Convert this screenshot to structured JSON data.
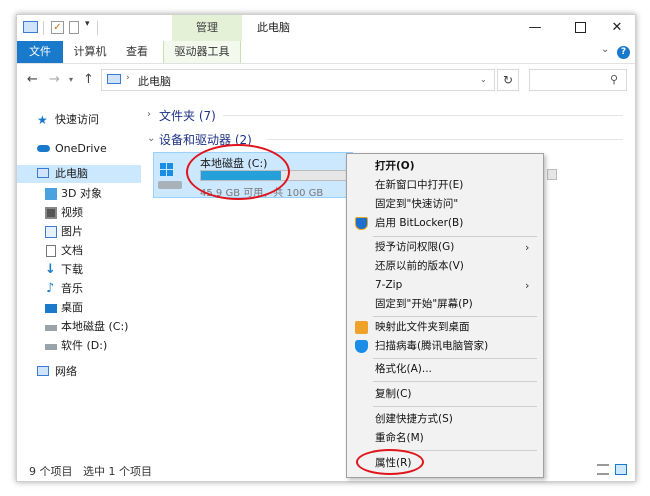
{
  "titlebar": {
    "window_title": "此电脑",
    "manage_tab": "管理",
    "minimize": "—",
    "close": "✕"
  },
  "ribbon": {
    "tabs": [
      "文件",
      "计算机",
      "查看",
      "驱动器工具"
    ],
    "help": "?"
  },
  "address": {
    "path": "此电脑"
  },
  "sidebar": {
    "items": [
      {
        "label": "快速访问",
        "icon": "star-icon"
      },
      {
        "label": "OneDrive",
        "icon": "cloud-icon"
      },
      {
        "label": "此电脑",
        "icon": "computer-icon",
        "selected": true
      },
      {
        "label": "3D 对象",
        "icon": "cube-icon"
      },
      {
        "label": "视频",
        "icon": "video-icon"
      },
      {
        "label": "图片",
        "icon": "image-icon"
      },
      {
        "label": "文档",
        "icon": "document-icon"
      },
      {
        "label": "下载",
        "icon": "download-icon"
      },
      {
        "label": "音乐",
        "icon": "music-icon"
      },
      {
        "label": "桌面",
        "icon": "desktop-icon"
      },
      {
        "label": "本地磁盘 (C:)",
        "icon": "drive-icon"
      },
      {
        "label": "软件 (D:)",
        "icon": "drive-icon"
      },
      {
        "label": "网络",
        "icon": "network-icon"
      }
    ]
  },
  "main": {
    "folders_header": "文件夹 (7)",
    "devices_header": "设备和驱动器 (2)",
    "drive_c": {
      "name": "本地磁盘 (C:)",
      "free_text": "45.9 GB 可用，共 100 GB",
      "used_fraction": 0.541
    }
  },
  "context_menu": {
    "items": [
      {
        "label": "打开(O)",
        "bold": true
      },
      {
        "label": "在新窗口中打开(E)"
      },
      {
        "label": "固定到\"快速访问\""
      },
      {
        "label": "启用 BitLocker(B)",
        "icon": "shield-icon"
      },
      {
        "label": "授予访问权限(G)",
        "submenu": true
      },
      {
        "label": "还原以前的版本(V)"
      },
      {
        "label": "7-Zip",
        "submenu": true
      },
      {
        "label": "固定到\"开始\"屏幕(P)"
      },
      {
        "label": "映射此文件夹到桌面",
        "icon": "folder-map-icon"
      },
      {
        "label": "扫描病毒(腾讯电脑管家)",
        "icon": "tencent-shield-icon"
      },
      {
        "label": "格式化(A)..."
      },
      {
        "label": "复制(C)"
      },
      {
        "label": "创建快捷方式(S)"
      },
      {
        "label": "重命名(M)"
      },
      {
        "label": "属性(R)"
      }
    ]
  },
  "statusbar": {
    "item_count": "9 个项目",
    "selected": "选中 1 个项目"
  },
  "colors": {
    "accent": "#1979ca",
    "selection": "#cce8ff",
    "manage_tab": "#e5f1d7",
    "annotation": "#e0151b"
  }
}
